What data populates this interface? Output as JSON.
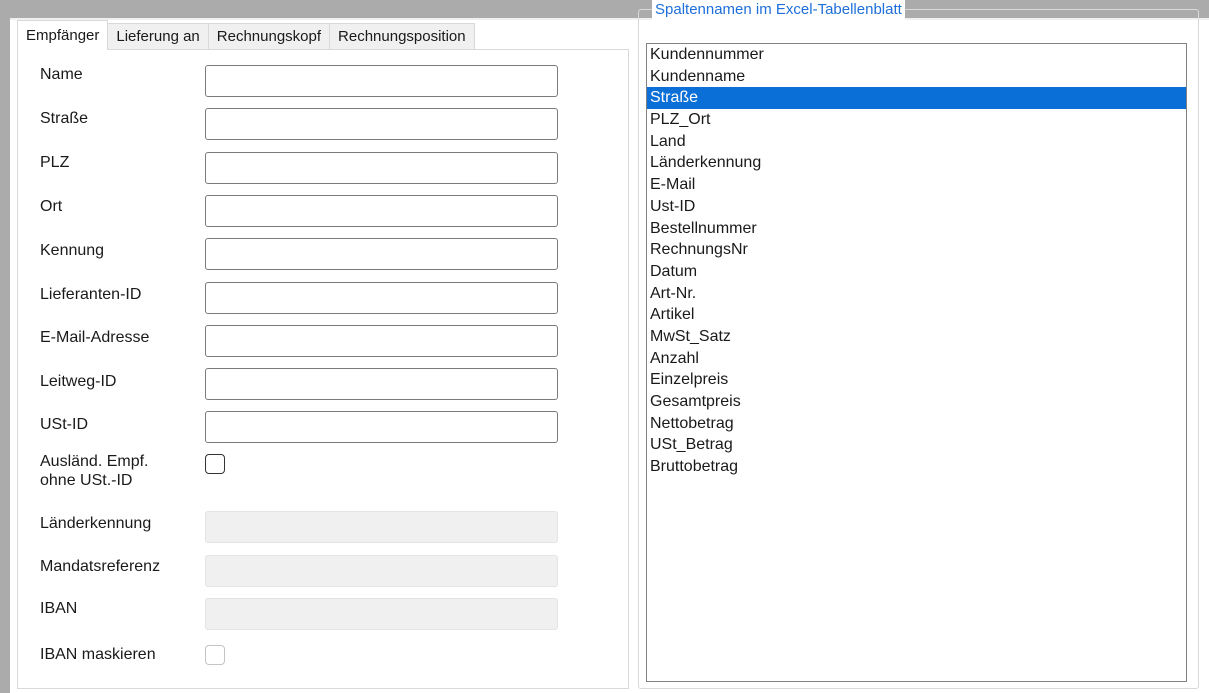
{
  "tabs": [
    "Empfänger",
    "Lieferung an",
    "Rechnungskopf",
    "Rechnungsposition"
  ],
  "form": {
    "name": "Name",
    "strasse": "Straße",
    "plz": "PLZ",
    "ort": "Ort",
    "kennung": "Kennung",
    "lieferanten_id": "Lieferanten-ID",
    "email": "E-Mail-Adresse",
    "leitweg_id": "Leitweg-ID",
    "ust_id": "USt-ID",
    "auslaend_line1": "Ausländ. Empf.",
    "auslaend_line2": "ohne USt.-ID",
    "laenderkennung": "Länderkennung",
    "mandatsreferenz": "Mandatsreferenz",
    "iban": "IBAN",
    "iban_maskieren": "IBAN maskieren"
  },
  "group": {
    "title": "Spaltennamen im Excel-Tabellenblatt",
    "selected_index": 2,
    "items": [
      "Kundennummer",
      "Kundenname",
      "Straße",
      "PLZ_Ort",
      "Land",
      "Länderkennung",
      "E-Mail",
      "Ust-ID",
      "Bestellnummer",
      "RechnungsNr",
      "Datum",
      "Art-Nr.",
      "Artikel",
      "MwSt_Satz",
      "Anzahl",
      "Einzelpreis",
      "Gesamtpreis",
      "Nettobetrag",
      "USt_Betrag",
      "Bruttobetrag"
    ]
  },
  "colors": {
    "selection": "#0b6fd8",
    "group_title": "#1e6fd9"
  }
}
